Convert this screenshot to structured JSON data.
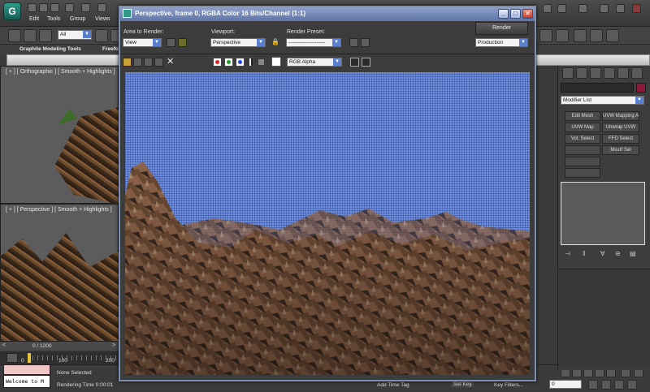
{
  "app": {
    "logo": "G",
    "menu": [
      "Edit",
      "Tools",
      "Group",
      "Views"
    ]
  },
  "toolbar": {
    "selection_filter": "All",
    "graphite_label": "Graphite Modeling Tools",
    "freeform_label": "Freefo"
  },
  "viewports": {
    "top_label": "[ + ] [ Orthographic ] [ Smooth + Highlights ]",
    "bottom_label": "[ + ] [ Perspective ] [ Smooth + Highlights ]"
  },
  "render_window": {
    "title": "Perspective, frame 0, RGBA Color 16 Bits/Channel (1:1)",
    "area_label": "Area to Render:",
    "area_value": "View",
    "viewport_label": "Viewport:",
    "viewport_value": "Perspective",
    "preset_label": "Render Preset:",
    "preset_value": "---------------------",
    "render_button": "Render",
    "mode_value": "Production",
    "channel_value": "RGB Alpha",
    "minimize": "_",
    "maximize": "□",
    "close": "×"
  },
  "command_panel": {
    "modifier_list": "Modifier List",
    "buttons": [
      "Edit Mesh",
      "UVW Mapping Ad",
      "UVW Map",
      "Unwrap UVW",
      "Vol. Select",
      "FFD Select",
      "",
      "Msurf Sel"
    ]
  },
  "timeline": {
    "frame_counter": "0 / 1200",
    "start": "0",
    "tick_100": "100",
    "tick_200": "200"
  },
  "status": {
    "listener_text": "Welcome to M",
    "selection": "None Selected",
    "render_time": "Rendering Time  0:00:01",
    "add_time_tag": "Add Time Tag",
    "set_key": "Set Key",
    "key_filters": "Key Filters...",
    "frame_field": "0"
  },
  "colors": {
    "accent_teal": "#2f9c8a",
    "title_blue": "#5f75a8",
    "sky_blue": "#5b77c6"
  }
}
